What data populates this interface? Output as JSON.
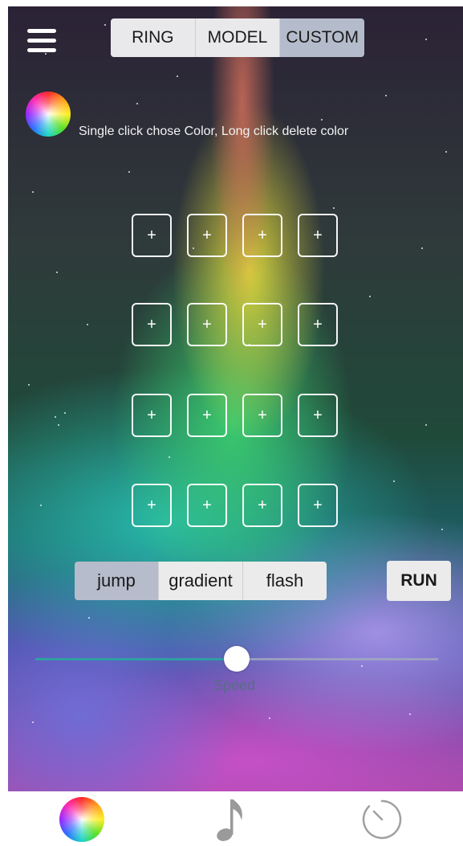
{
  "top_tabs": [
    {
      "label": "RING",
      "active": false
    },
    {
      "label": "MODEL",
      "active": false
    },
    {
      "label": "CUSTOM",
      "active": true
    }
  ],
  "hint_text": "Single click chose Color, Long click delete color",
  "color_slots": [
    "+",
    "+",
    "+",
    "+",
    "+",
    "+",
    "+",
    "+",
    "+",
    "+",
    "+",
    "+",
    "+",
    "+",
    "+",
    "+"
  ],
  "modes": [
    {
      "label": "jump",
      "active": true
    },
    {
      "label": "gradient",
      "active": false
    },
    {
      "label": "flash",
      "active": false
    }
  ],
  "run_label": "RUN",
  "speed": {
    "label": "Speed",
    "fraction": 0.5
  },
  "bottom_nav": [
    {
      "icon": "color-wheel-icon"
    },
    {
      "icon": "music-note-icon"
    },
    {
      "icon": "timer-icon"
    }
  ],
  "colors": {
    "accent": "#2f9fa3",
    "segment_active": "#b4bccb",
    "segment_inactive": "#e9e9eb"
  }
}
